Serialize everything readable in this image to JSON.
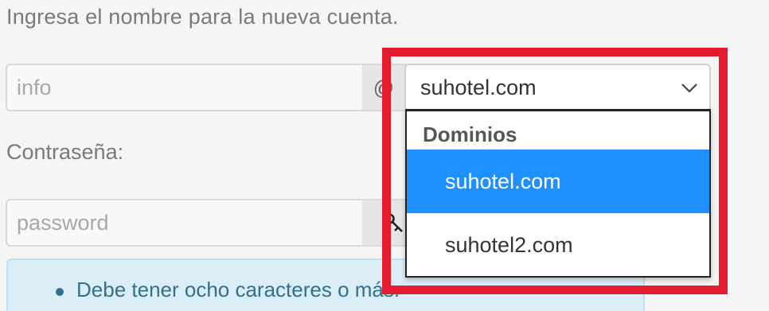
{
  "form": {
    "prompt": "Ingresa el nombre para la nueva cuenta.",
    "username": {
      "value": "",
      "placeholder": "info"
    },
    "at_symbol": "@",
    "domain_select": {
      "selected": "suhotel.com",
      "icon": "chevron-down-icon"
    },
    "password_label": "Contraseña:",
    "password": {
      "value": "",
      "placeholder": "password",
      "icon": "key-icon"
    },
    "info": {
      "items": [
        "Debe tener ocho caracteres o más."
      ]
    }
  },
  "dropdown": {
    "group_label": "Dominios",
    "options": [
      {
        "label": "suhotel.com",
        "selected": true
      },
      {
        "label": "suhotel2.com",
        "selected": false
      }
    ]
  },
  "colors": {
    "highlight_frame": "#e31b2e",
    "selected_option_bg": "#1e90ff",
    "info_text": "#31708f",
    "info_bg": "#dbeef7"
  }
}
